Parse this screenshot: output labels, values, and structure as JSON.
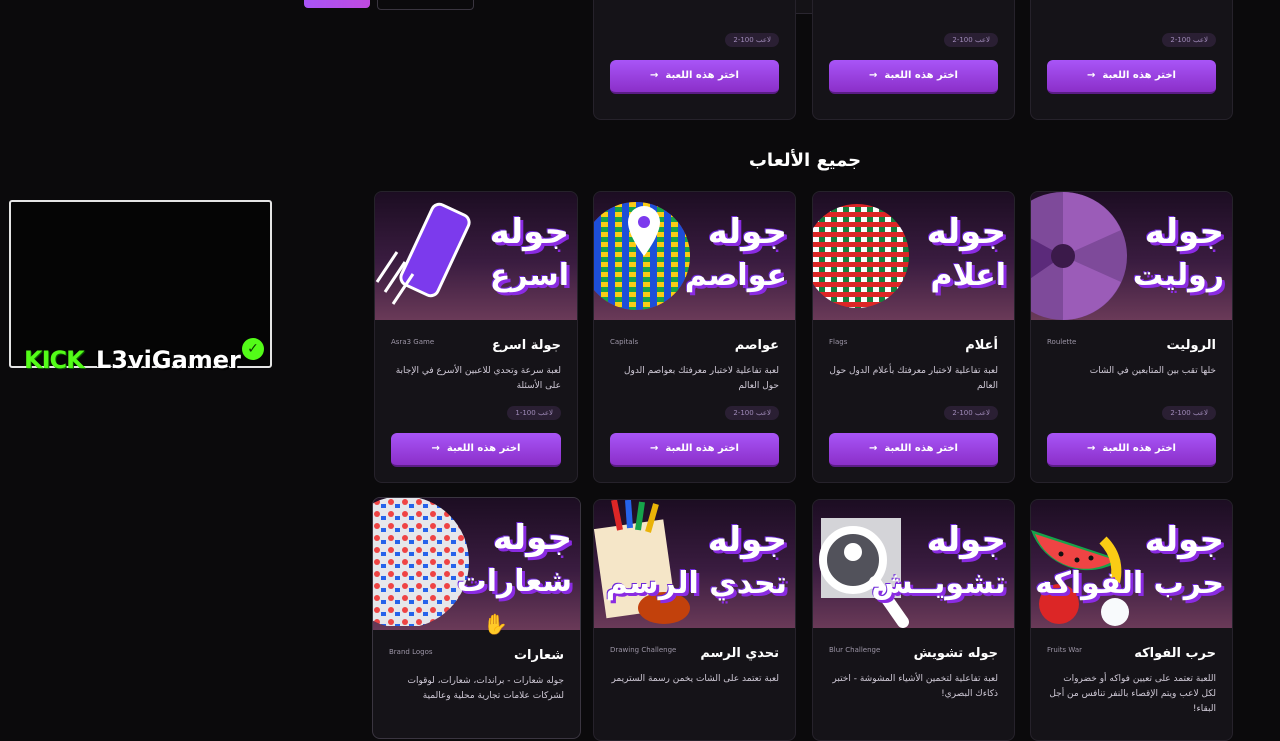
{
  "section_title": "جميع الألعاب",
  "choose_label": "اختر هذه اللعبة",
  "arrow": "→",
  "top_cards": [
    {
      "players": "2-100 لاعب"
    },
    {
      "players": "2-100 لاعب"
    },
    {
      "players": "2-100 لاعب"
    }
  ],
  "games": [
    {
      "title": "جولة اسرع",
      "en": "Asra3 Game",
      "desc": "لعبة سرعة وتحدي للاعبين الأسرع في الإجابة على الأسئلة",
      "players": "1-100 لاعب",
      "banner1": "جوله",
      "banner2": "اسرع",
      "icon": "keyboard-icon"
    },
    {
      "title": "عواصم",
      "en": "Capitals",
      "desc": "لعبة تفاعلية لاختبار معرفتك بعواصم الدول حول العالم",
      "players": "2-100 لاعب",
      "banner1": "جوله",
      "banner2": "عواصم",
      "icon": "globe-pin-icon"
    },
    {
      "title": "أعلام",
      "en": "Flags",
      "desc": "لعبة تفاعلية لاختبار معرفتك بأعلام الدول حول العالم",
      "players": "2-100 لاعب",
      "banner1": "جوله",
      "banner2": "اعلام",
      "icon": "flags-globe-icon"
    },
    {
      "title": "الروليت",
      "en": "Roulette",
      "desc": "خلها تقب بين المتابعين في الشات",
      "players": "2-100 لاعب",
      "banner1": "جوله",
      "banner2": "روليت",
      "icon": "roulette-wheel-icon"
    },
    {
      "title": "شعارات",
      "en": "Brand Logos",
      "desc": "جوله شعارات - براندات، شعارات، لوقوات لشركات علامات تجارية محلية وعالمية",
      "banner1": "جوله",
      "banner2": "شعارات",
      "icon": "logos-globe-icon"
    },
    {
      "title": "تحدي الرسم",
      "en": "Drawing Challenge",
      "desc": "لعبة تعتمد على الشات يخمن رسمة الستريمر",
      "banner1": "جوله",
      "banner2": "تحدي الرسم",
      "icon": "drawing-pencils-icon"
    },
    {
      "title": "جوله تشويش",
      "en": "Blur Challenge",
      "desc": "لعبة تفاعلية لتخمين الأشياء المشوشة - اختبر ذكاءك البصري!",
      "banner1": "جوله",
      "banner2": "تشويــش",
      "icon": "magnifier-icon"
    },
    {
      "title": "حرب الفواكه",
      "en": "Fruits War",
      "desc": "اللعبة تعتمد على تعيين فواكه أو خضروات لكل لاعب ويتم الإقصاء بالنفر تنافس من أجل البقاء!",
      "banner1": "جوله",
      "banner2": "حرب الفواكه",
      "icon": "watermelon-icon"
    }
  ],
  "stream": {
    "kick": "KICK",
    "name": "L3viGamer",
    "verified": "✓"
  },
  "colors": {
    "accent": "#a855f7",
    "kick_green": "#53fc18",
    "background": "#0b0a0c",
    "card": "#151318"
  }
}
